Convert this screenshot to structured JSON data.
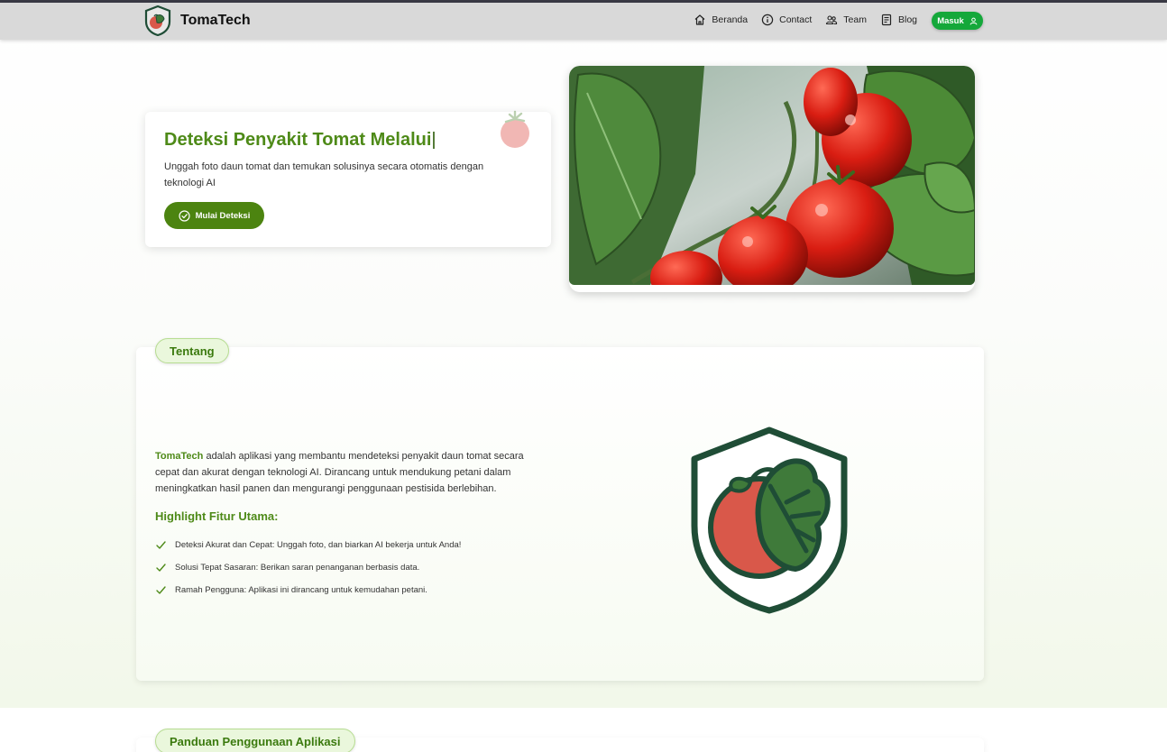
{
  "navbar": {
    "brand": "TomaTech",
    "links": [
      {
        "label": "Beranda",
        "icon": "home-icon"
      },
      {
        "label": "Contact",
        "icon": "info-icon"
      },
      {
        "label": "Team",
        "icon": "team-icon"
      },
      {
        "label": "Blog",
        "icon": "blog-icon"
      }
    ],
    "login_label": "Masuk",
    "login_icon": "user-icon"
  },
  "hero": {
    "title": "Deteksi Penyakit Tomat Melalui",
    "cursor": "|",
    "description": "Unggah foto daun tomat dan temukan solusinya secara otomatis dengan teknologi AI",
    "button_label": "Mulai Deteksi",
    "button_icon": "check-circle-icon"
  },
  "about": {
    "pill": "Tentang",
    "brand_highlight": "TomaTech",
    "text": " adalah aplikasi yang membantu mendeteksi penyakit daun tomat secara cepat dan akurat dengan teknologi AI. Dirancang untuk mendukung petani dalam meningkatkan hasil panen dan mengurangi penggunaan pestisida berlebihan.",
    "features_title": "Highlight Fitur Utama:",
    "features": [
      "Deteksi Akurat dan Cepat: Unggah foto, dan biarkan AI bekerja untuk Anda!",
      "Solusi Tepat Sasaran: Berikan saran penanganan berbasis data.",
      "Ramah Pengguna: Aplikasi ini dirancang untuk kemudahan petani."
    ]
  },
  "guide": {
    "pill": "Panduan Penggunaan Aplikasi"
  },
  "colors": {
    "brand_green": "#4e8a18",
    "button_green": "#4c8410",
    "login_green": "#14a83a",
    "navbar_bg": "#d9d9d9",
    "logo_dark": "#1f4d36",
    "logo_red": "#d9584a"
  }
}
